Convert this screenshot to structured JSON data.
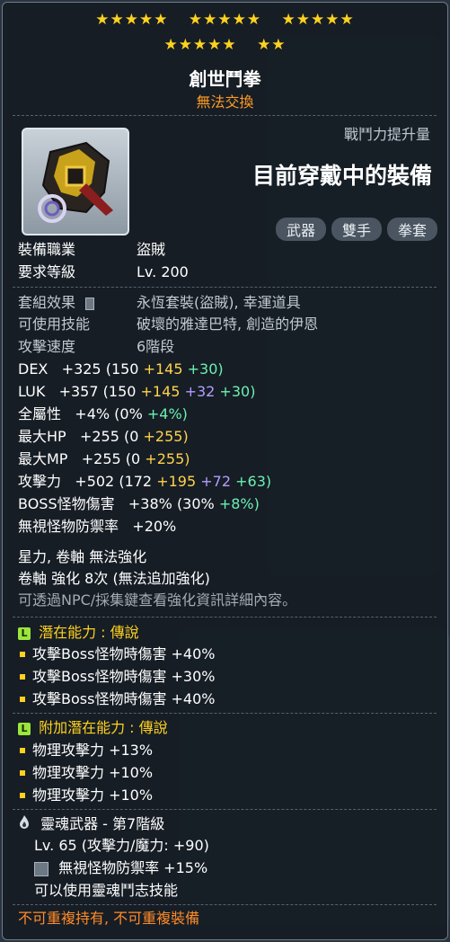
{
  "stars": {
    "row1": [
      "★★★★★",
      "★★★★★",
      "★★★★★"
    ],
    "row2": [
      "★★★★★",
      "★★"
    ]
  },
  "item": {
    "name": "創世鬥拳",
    "trade": "無法交換"
  },
  "header": {
    "power_label": "戰鬥力提升量",
    "power_value": "目前穿戴中的裝備",
    "tags": [
      "武器",
      "雙手",
      "拳套"
    ]
  },
  "req": {
    "job_label": "裝備職業",
    "job_value": "盜賊",
    "level_label": "要求等級",
    "level_value": "Lv. 200"
  },
  "info": {
    "set_label": "套組效果",
    "set_value": "永恆套裝(盜賊), 幸運道具",
    "skill_label": "可使用技能",
    "skill_value": "破壞的雅達巴特, 創造的伊恩",
    "speed_label": "攻擊速度",
    "speed_value": "6階段"
  },
  "stats": {
    "dex": {
      "label": "DEX",
      "total": "+325",
      "base": "(150",
      "a": "+145",
      "b": "+30)"
    },
    "luk": {
      "label": "LUK",
      "total": "+357",
      "base": "(150",
      "a": "+145",
      "c": "+32",
      "b": "+30)"
    },
    "allstat": {
      "label": "全屬性",
      "total": "+4%",
      "base": "(0%",
      "b": "+4%)"
    },
    "hp": {
      "label": "最大HP",
      "total": "+255",
      "base": "(0",
      "a": "+255)"
    },
    "mp": {
      "label": "最大MP",
      "total": "+255",
      "base": "(0",
      "a": "+255)"
    },
    "atk": {
      "label": "攻擊力",
      "total": "+502",
      "base": "(172",
      "a": "+195",
      "c": "+72",
      "b": "+63)"
    },
    "boss": {
      "label": "BOSS怪物傷害",
      "total": "+38%",
      "base": "(30%",
      "b": "+8%)"
    },
    "ignore": {
      "label": "無視怪物防禦率",
      "total": "+20%"
    }
  },
  "enhance": {
    "line1": "星力, 卷軸 無法強化",
    "line2": "卷軸 強化 8次 (無法追加強化)",
    "line3": "可透過NPC/採集鍵查看強化資訊詳細內容。"
  },
  "potential": {
    "icon": "L",
    "title": "潛在能力 : 傳說",
    "lines": [
      "攻擊Boss怪物時傷害 +40%",
      "攻擊Boss怪物時傷害 +30%",
      "攻擊Boss怪物時傷害 +40%"
    ]
  },
  "bonus": {
    "icon": "L",
    "title": "附加潛在能力 : 傳說",
    "lines": [
      "物理攻擊力 +13%",
      "物理攻擊力 +10%",
      "物理攻擊力 +10%"
    ]
  },
  "soul": {
    "title": "靈魂武器 - 第7階級",
    "level": "Lv. 65 (攻擊力/魔力: +90)",
    "effect": "無視怪物防禦率 +15%",
    "skill": "可以使用靈魂鬥志技能"
  },
  "footer": "不可重複持有, 不可重複裝備"
}
